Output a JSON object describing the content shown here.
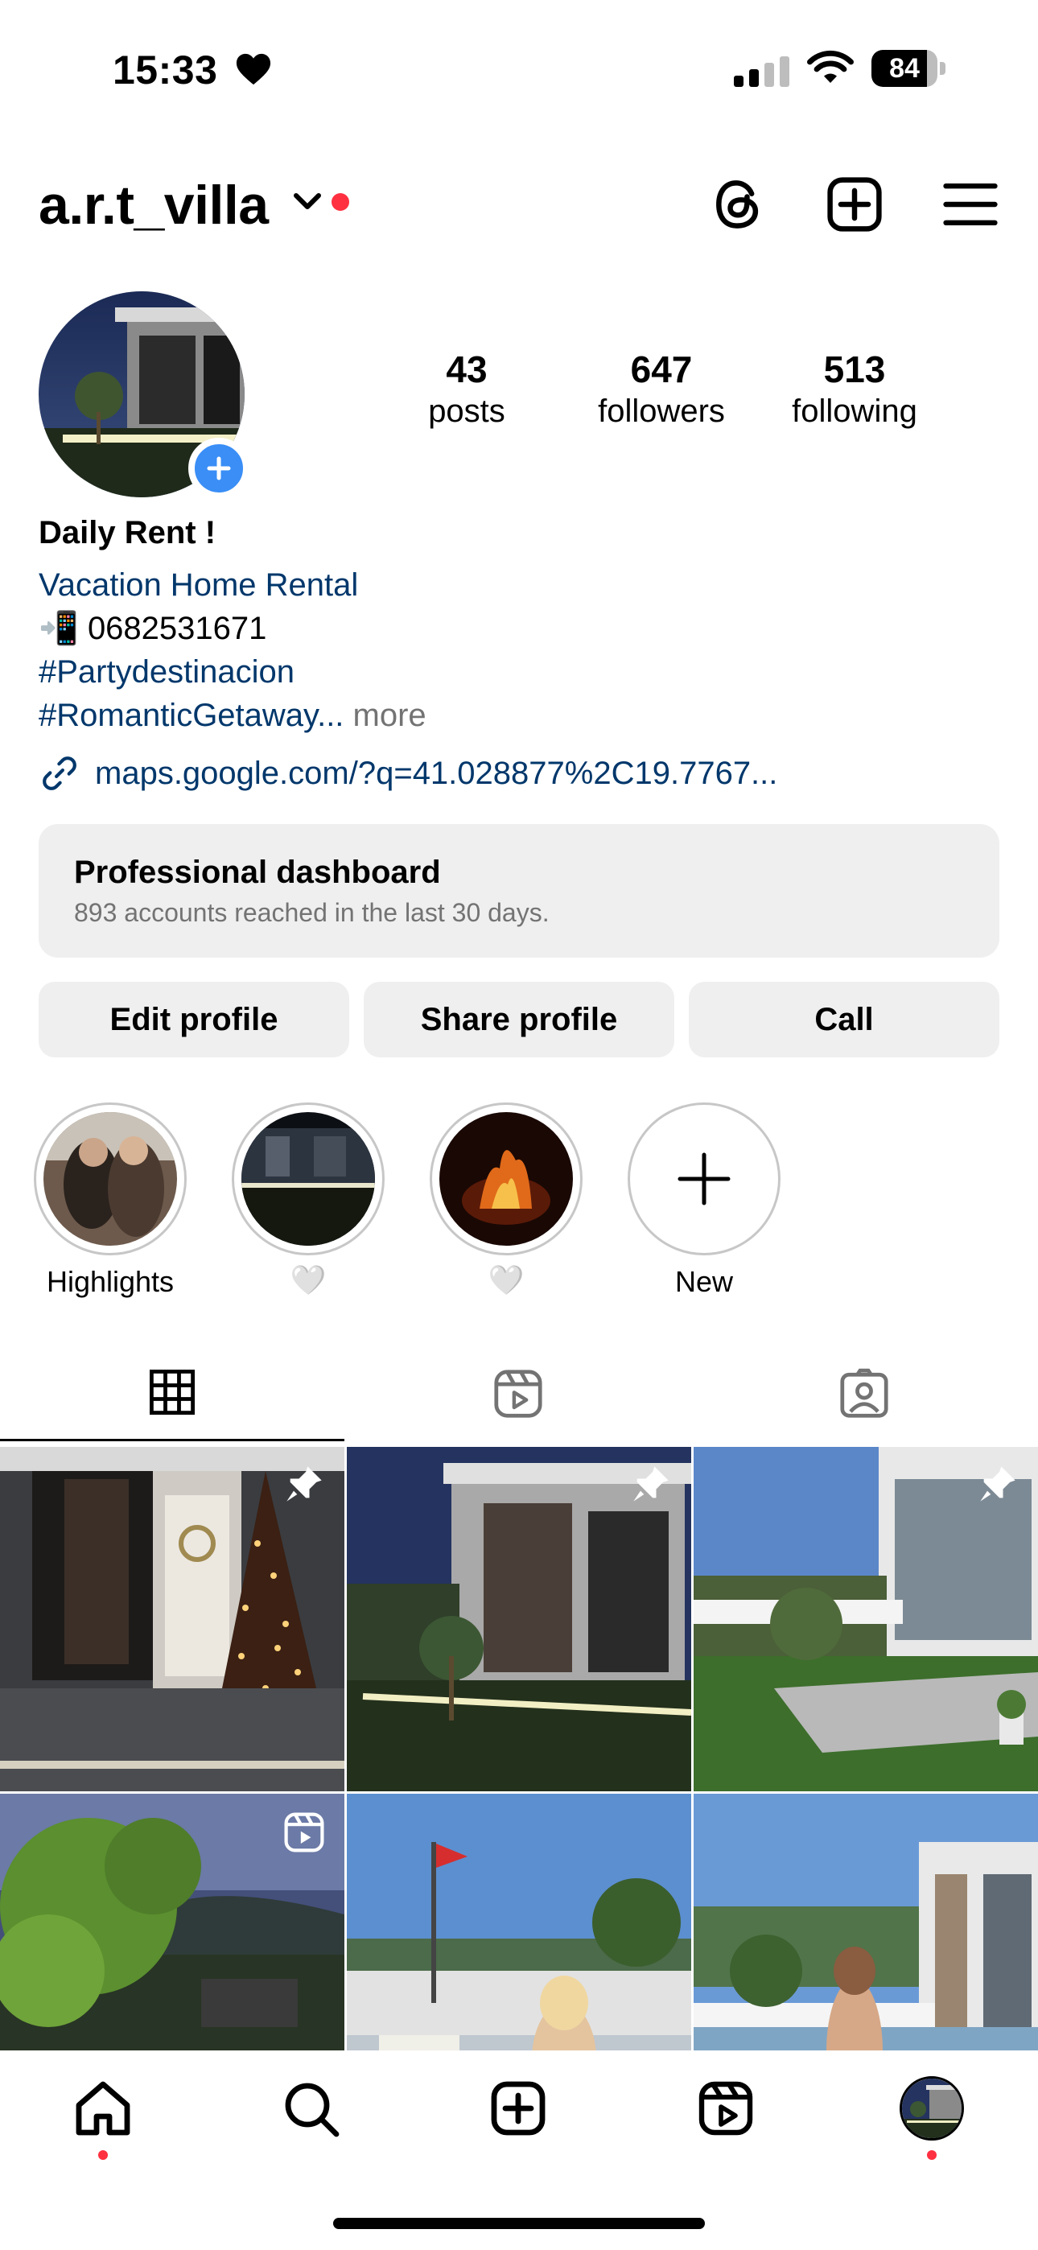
{
  "status_bar": {
    "time": "15:33",
    "battery_percent": "84",
    "icons": [
      "heart-icon",
      "signal-icon",
      "wifi-icon",
      "battery-icon"
    ]
  },
  "header": {
    "username": "a.r.t_villa",
    "icons": [
      "threads-icon",
      "create-icon",
      "menu-icon"
    ]
  },
  "stats": [
    {
      "number": "43",
      "label": "posts"
    },
    {
      "number": "647",
      "label": "followers"
    },
    {
      "number": "513",
      "label": "following"
    }
  ],
  "bio": {
    "name": "Daily Rent !",
    "category": "Vacation Home Rental",
    "phone_emoji": "📲",
    "phone": "0682531671",
    "hashtag1": "#Partydestinacion",
    "hashtag2": "#RomanticGetaway...",
    "more": "more",
    "link": "maps.google.com/?q=41.028877%2C19.7767..."
  },
  "dashboard": {
    "title": "Professional dashboard",
    "subtitle": "893 accounts reached in the last 30 days."
  },
  "actions": {
    "edit": "Edit profile",
    "share": "Share profile",
    "call": "Call"
  },
  "highlights": [
    {
      "label": "Highlights"
    },
    {
      "label": "🤍"
    },
    {
      "label": "🤍"
    },
    {
      "label": "New"
    }
  ],
  "tabs": [
    "grid-tab",
    "reels-tab",
    "tagged-tab"
  ],
  "posts": [
    {
      "type": "pinned",
      "icon": "pin-icon"
    },
    {
      "type": "pinned",
      "icon": "pin-icon"
    },
    {
      "type": "pinned",
      "icon": "pin-icon"
    },
    {
      "type": "reel",
      "icon": "reel-icon"
    },
    {
      "type": "photo"
    },
    {
      "type": "photo"
    }
  ],
  "bottom_nav": [
    "home",
    "search",
    "create",
    "reels",
    "profile"
  ],
  "colors": {
    "accent_blue": "#3a8ef6",
    "link_blue": "#00376b",
    "notification_red": "#ff3040",
    "button_gray": "#efefef"
  }
}
